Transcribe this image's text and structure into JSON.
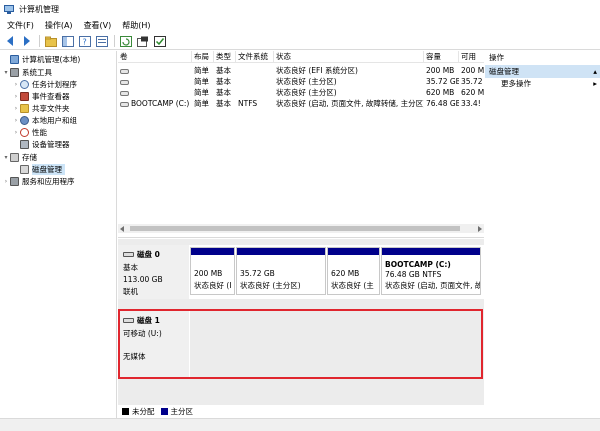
{
  "window": {
    "title": "计算机管理"
  },
  "menu": [
    "文件(F)",
    "操作(A)",
    "查看(V)",
    "帮助(H)"
  ],
  "tree": {
    "root": "计算机管理(本地)",
    "system_tools": "系统工具",
    "task_scheduler": "任务计划程序",
    "event_viewer": "事件查看器",
    "shared_folders": "共享文件夹",
    "local_users": "本地用户和组",
    "performance": "性能",
    "device_manager": "设备管理器",
    "storage": "存储",
    "disk_management": "磁盘管理",
    "services": "服务和应用程序"
  },
  "table": {
    "headers": [
      "卷",
      "布局",
      "类型",
      "文件系统",
      "状态",
      "容量",
      "可用"
    ],
    "rows": [
      [
        "",
        "简单",
        "基本",
        "",
        "状态良好 (EFI 系统分区)",
        "200 MB",
        "200 MB"
      ],
      [
        "",
        "简单",
        "基本",
        "",
        "状态良好 (主分区)",
        "35.72 GB",
        "35.72"
      ],
      [
        "",
        "简单",
        "基本",
        "",
        "状态良好 (主分区)",
        "620 MB",
        "620 MB"
      ],
      [
        "BOOTCAMP (C:)",
        "简单",
        "基本",
        "NTFS",
        "状态良好 (启动, 页面文件, 故障转储, 主分区)",
        "76.48 GB",
        "33.4!"
      ]
    ]
  },
  "disk0": {
    "name": "磁盘 0",
    "type": "基本",
    "size": "113.00 GB",
    "status": "联机",
    "partitions": [
      {
        "line1": "",
        "line2": "200 MB",
        "line3": "状态良好 (I"
      },
      {
        "line1": "",
        "line2": "35.72 GB",
        "line3": "状态良好 (主分区)"
      },
      {
        "line1": "",
        "line2": "620 MB",
        "line3": "状态良好 (主"
      },
      {
        "line1": "BOOTCAMP (C:)",
        "line2": "76.48 GB NTFS",
        "line3": "状态良好 (启动, 页面文件, 故"
      }
    ]
  },
  "disk1": {
    "name": "磁盘 1",
    "type": "可移动 (U:)",
    "status": "无媒体"
  },
  "legend": {
    "unallocated": "未分配",
    "primary": "主分区",
    "unallocated_color": "#000000",
    "primary_color": "#00008b"
  },
  "actions": {
    "header": "操作",
    "section": "磁盘管理",
    "more": "更多操作"
  }
}
